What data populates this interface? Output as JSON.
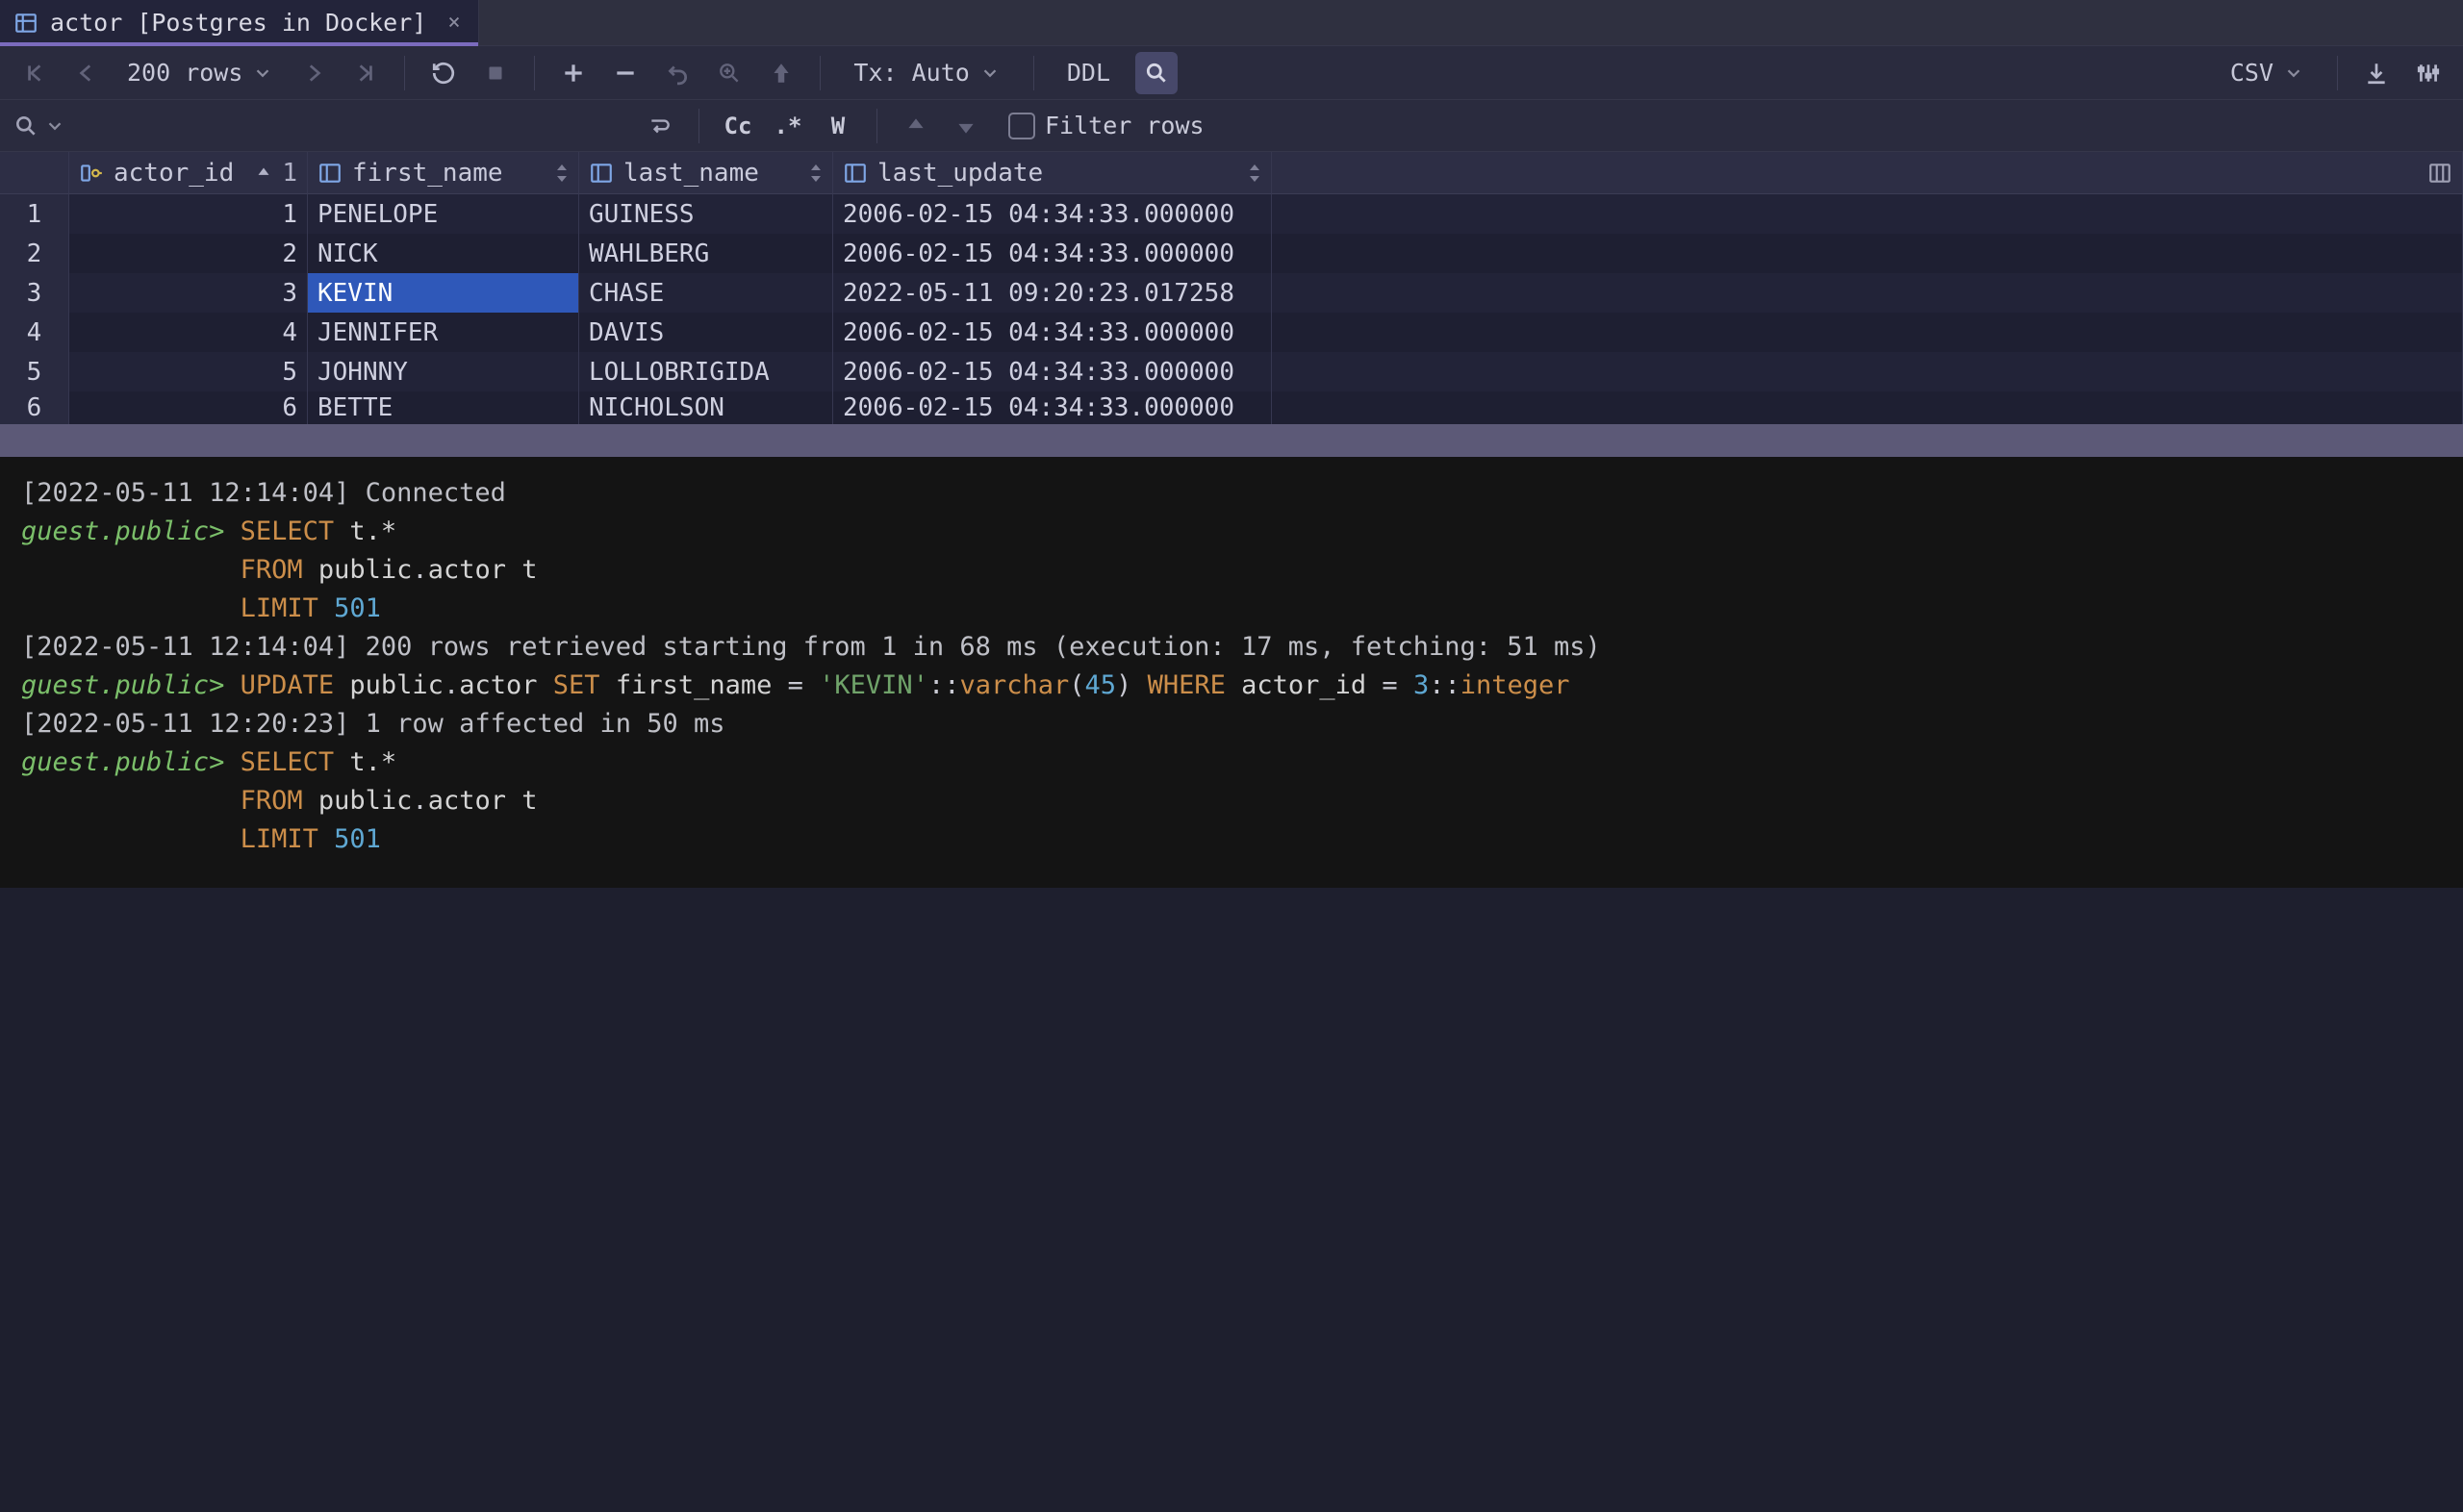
{
  "tab": {
    "title": "actor [Postgres in Docker]",
    "close_glyph": "×"
  },
  "toolbar": {
    "rows_label": "200 rows",
    "tx_label": "Tx: Auto",
    "ddl_label": "DDL",
    "csv_label": "CSV"
  },
  "filter": {
    "cc": "Cc",
    "dotstar": ".*",
    "w": "W",
    "label": "Filter rows"
  },
  "columns": {
    "id": "actor_id",
    "id_sort_order": "1",
    "first": "first_name",
    "last": "last_name",
    "update": "last_update"
  },
  "rows": [
    {
      "n": "1",
      "id": "1",
      "first": "PENELOPE",
      "last": "GUINESS",
      "update": "2006-02-15 04:34:33.000000"
    },
    {
      "n": "2",
      "id": "2",
      "first": "NICK",
      "last": "WAHLBERG",
      "update": "2006-02-15 04:34:33.000000"
    },
    {
      "n": "3",
      "id": "3",
      "first": "KEVIN",
      "last": "CHASE",
      "update": "2022-05-11 09:20:23.017258"
    },
    {
      "n": "4",
      "id": "4",
      "first": "JENNIFER",
      "last": "DAVIS",
      "update": "2006-02-15 04:34:33.000000"
    },
    {
      "n": "5",
      "id": "5",
      "first": "JOHNNY",
      "last": "LOLLOBRIGIDA",
      "update": "2006-02-15 04:34:33.000000"
    },
    {
      "n": "6",
      "id": "6",
      "first": "BETTE",
      "last": "NICHOLSON",
      "update": "2006-02-15 04:34:33.000000"
    }
  ],
  "selected": {
    "row": 2,
    "col": "first"
  },
  "console": {
    "l1_ts": "[2022-05-11 12:14:04]",
    "l1_msg": "Connected",
    "prompt": "guest.public>",
    "select_kw": "SELECT",
    "t_star": "t.*",
    "from_kw": "FROM",
    "schema": "public",
    "dot": ".",
    "table": "actor",
    "alias": "t",
    "limit_kw": "LIMIT",
    "limit_n": "501",
    "l4_ts": "[2022-05-11 12:14:04]",
    "l4_msg": "200 rows retrieved starting from 1 in 68 ms (execution: 17 ms, fetching: 51 ms)",
    "update_kw": "UPDATE",
    "set_kw": "SET",
    "col_fn": "first_name",
    "eq": " = ",
    "val_str": "'KEVIN'",
    "cast1": "::",
    "type_vc": "varchar",
    "lparen": "(",
    "vc_len": "45",
    "rparen": ")",
    "where_kw": "WHERE",
    "col_id": "actor_id",
    "val_id": "3",
    "type_int": "integer",
    "l6_ts": "[2022-05-11 12:20:23]",
    "l6_msg": "1 row affected in 50 ms"
  }
}
